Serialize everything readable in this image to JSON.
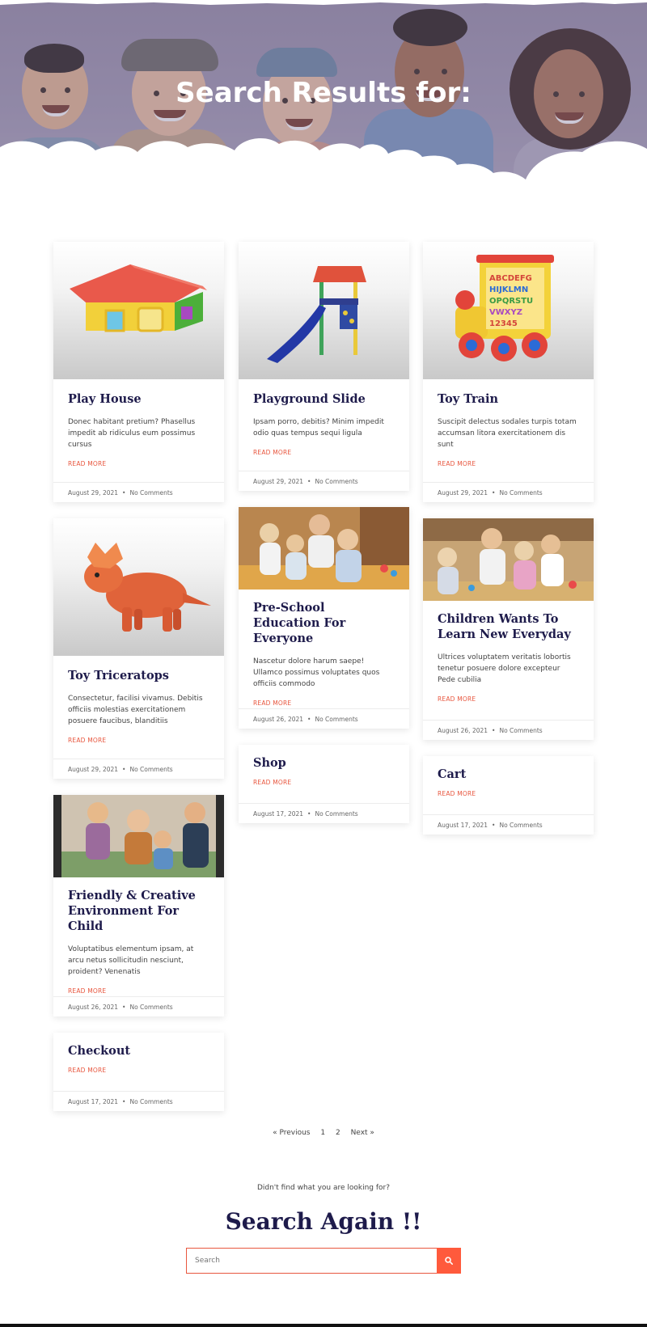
{
  "hero": {
    "title": "Search Results for:"
  },
  "posts": [
    {
      "title": "Play House",
      "excerpt": "Donec habitant pretium? Phasellus impedit ab ridiculus eum possimus cursus",
      "read_more": "READ MORE",
      "date": "August 29, 2021",
      "comments": "No Comments",
      "image": "play-house"
    },
    {
      "title": "Playground Slide",
      "excerpt": "Ipsam porro, debitis? Minim impedit odio quas tempus sequi ligula",
      "read_more": "READ MORE",
      "date": "August 29, 2021",
      "comments": "No Comments",
      "image": "playground-slide"
    },
    {
      "title": "Toy Train",
      "excerpt": "Suscipit delectus sodales turpis totam accumsan litora exercitationem dis sunt",
      "read_more": "READ MORE",
      "date": "August 29, 2021",
      "comments": "No Comments",
      "image": "toy-train"
    },
    {
      "title": "Toy Triceratops",
      "excerpt": "Consectetur, facilisi vivamus. Debitis officiis molestias exercitationem posuere faucibus, blanditiis",
      "read_more": "READ MORE",
      "date": "August 29, 2021",
      "comments": "No Comments",
      "image": "toy-triceratops"
    },
    {
      "title": "Pre-School Education For Everyone",
      "excerpt": "Nascetur dolore harum saepe! Ullamco possimus voluptates quos officiis commodo",
      "read_more": "READ MORE",
      "date": "August 26, 2021",
      "comments": "No Comments",
      "image": "classroom-photo"
    },
    {
      "title": "Children Wants To Learn New Everyday",
      "excerpt": "Ultrices voluptatem veritatis lobortis tenetur posuere dolore excepteur Pede cubilia",
      "read_more": "READ MORE",
      "date": "August 26, 2021",
      "comments": "No Comments",
      "image": "learning-photo"
    },
    {
      "title": "Friendly & Creative Environment For Child",
      "excerpt": "Voluptatibus elementum ipsam, at arcu netus sollicitudin nesciunt, proident? Venenatis",
      "read_more": "READ MORE",
      "date": "August 26, 2021",
      "comments": "No Comments",
      "image": "playtime-photo"
    },
    {
      "title": "Shop",
      "read_more": "READ MORE",
      "date": "August 17, 2021",
      "comments": "No Comments"
    },
    {
      "title": "Cart",
      "read_more": "READ MORE",
      "date": "August 17, 2021",
      "comments": "No Comments"
    },
    {
      "title": "Checkout",
      "read_more": "READ MORE",
      "date": "August 17, 2021",
      "comments": "No Comments"
    }
  ],
  "meta_separator": "•",
  "pagination": {
    "previous": "« Previous",
    "pages": [
      "1",
      "2"
    ],
    "next": "Next »"
  },
  "search_section": {
    "not_found_text": "Didn't find what you are looking for?",
    "heading": "Search Again !!",
    "placeholder": "Search",
    "button_icon": "search-icon"
  },
  "colors": {
    "accent": "#ff5a3c",
    "title": "#1e1b4b"
  }
}
